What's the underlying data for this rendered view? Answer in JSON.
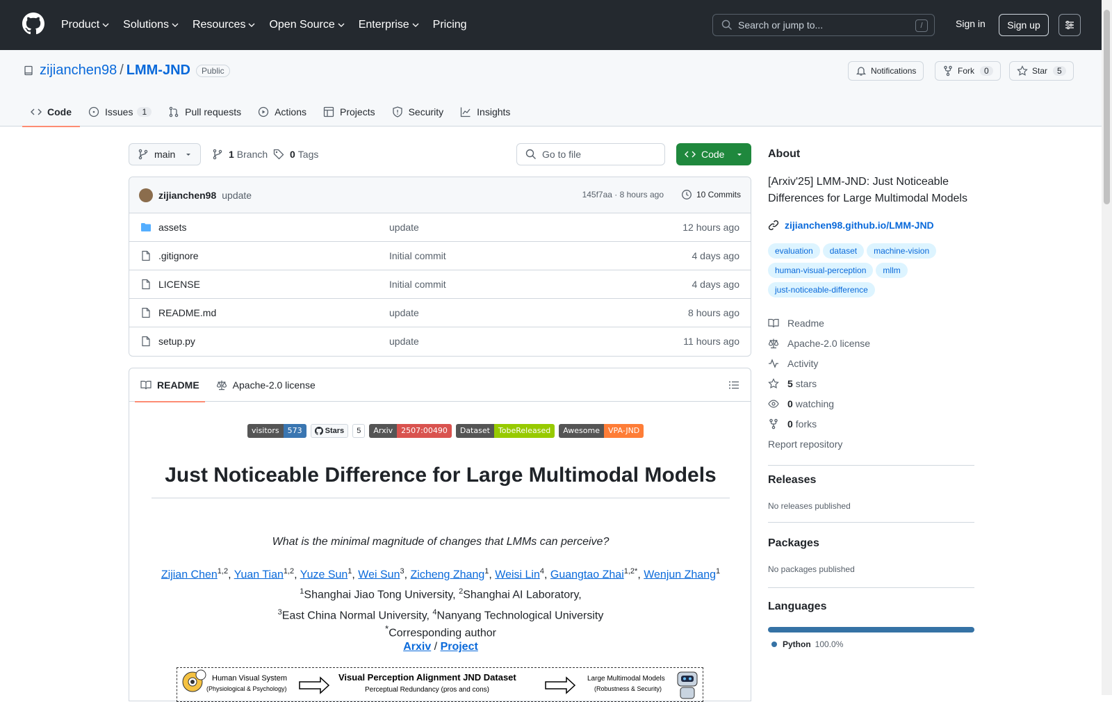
{
  "nav": {
    "items": [
      "Product",
      "Solutions",
      "Resources",
      "Open Source",
      "Enterprise",
      "Pricing"
    ],
    "search_placeholder": "Search or jump to...",
    "search_shortcut": "/",
    "sign_in": "Sign in",
    "sign_up": "Sign up"
  },
  "repo": {
    "owner": "zijianchen98",
    "name": "LMM-JND",
    "visibility": "Public",
    "notifications": "Notifications",
    "fork_label": "Fork",
    "fork_count": "0",
    "star_label": "Star",
    "star_count": "5"
  },
  "tabs": {
    "code": "Code",
    "issues": "Issues",
    "issues_count": "1",
    "pulls": "Pull requests",
    "actions": "Actions",
    "projects": "Projects",
    "security": "Security",
    "insights": "Insights"
  },
  "toolbar": {
    "branch": "main",
    "branch_count": "1",
    "branch_label": "Branch",
    "tag_count": "0",
    "tag_label": "Tags",
    "go_to_file": "Go to file",
    "code_button": "Code"
  },
  "commit": {
    "author": "zijianchen98",
    "message": "update",
    "hash_time": "145f7aa · 8 hours ago",
    "commits": "10 Commits"
  },
  "files": [
    {
      "name": "assets",
      "message": "update",
      "time": "12 hours ago",
      "type": "folder"
    },
    {
      "name": ".gitignore",
      "message": "Initial commit",
      "time": "4 days ago",
      "type": "file"
    },
    {
      "name": "LICENSE",
      "message": "Initial commit",
      "time": "4 days ago",
      "type": "file"
    },
    {
      "name": "README.md",
      "message": "update",
      "time": "8 hours ago",
      "type": "file"
    },
    {
      "name": "setup.py",
      "message": "update",
      "time": "11 hours ago",
      "type": "file"
    }
  ],
  "readme": {
    "tab_readme": "README",
    "tab_license": "Apache-2.0 license",
    "badges": {
      "visitors_l": "visitors",
      "visitors_r": "573",
      "stars_l": "Stars",
      "stars_r": "5",
      "arxiv_l": "Arxiv",
      "arxiv_r": "2507:00490",
      "dataset_l": "Dataset",
      "dataset_r": "TobeReleased",
      "awesome_l": "Awesome",
      "awesome_r": "VPA-JND"
    },
    "title": "Just Noticeable Difference for Large Multimodal Models",
    "question": "What is the minimal magnitude of changes that LMMs can perceive?",
    "authors": [
      {
        "name": "Zijian Chen",
        "sup": "1,2"
      },
      {
        "name": "Yuan Tian",
        "sup": "1,2"
      },
      {
        "name": "Yuze Sun",
        "sup": "1"
      },
      {
        "name": "Wei Sun",
        "sup": "3"
      },
      {
        "name": "Zicheng Zhang",
        "sup": "1"
      },
      {
        "name": "Weisi Lin",
        "sup": "4"
      },
      {
        "name": "Guangtao Zhai",
        "sup": "1,2*"
      },
      {
        "name": "Wenjun Zhang",
        "sup": "1"
      }
    ],
    "aff1_sup": "1",
    "aff1": "Shanghai Jiao Tong University, ",
    "aff2_sup": "2",
    "aff2": "Shanghai AI Laboratory,",
    "aff3_sup": "3",
    "aff3": "East China Normal University, ",
    "aff4_sup": "4",
    "aff4": "Nanyang Technological University",
    "corr_sup": "*",
    "corr": "Corresponding author",
    "link_arxiv": "Arxiv",
    "link_sep": " / ",
    "link_project": "Project",
    "diagram": {
      "left_title": "Human Visual System",
      "left_sub": "(Physiological & Psychology)",
      "mid_title": "Visual Perception Alignment JND Dataset",
      "mid_sub": "Perceptual Redundancy (pros and cons)",
      "right_title": "Large Multimodal Models",
      "right_sub": "(Robustness & Security)"
    }
  },
  "about": {
    "heading": "About",
    "description": "[Arxiv'25] LMM-JND: Just Noticeable Differences for Large Multimodal Models",
    "link": "zijianchen98.github.io/LMM-JND",
    "topics": [
      "evaluation",
      "dataset",
      "machine-vision",
      "human-visual-perception",
      "mllm",
      "just-noticeable-difference"
    ],
    "readme": "Readme",
    "license": "Apache-2.0 license",
    "activity": "Activity",
    "stars_n": "5",
    "stars": "stars",
    "watching_n": "0",
    "watching": "watching",
    "forks_n": "0",
    "forks": "forks",
    "report": "Report repository"
  },
  "releases": {
    "heading": "Releases",
    "text": "No releases published"
  },
  "packages": {
    "heading": "Packages",
    "text": "No packages published"
  },
  "languages": {
    "heading": "Languages",
    "name": "Python",
    "percent": "100.0%",
    "color": "#3572a5"
  }
}
